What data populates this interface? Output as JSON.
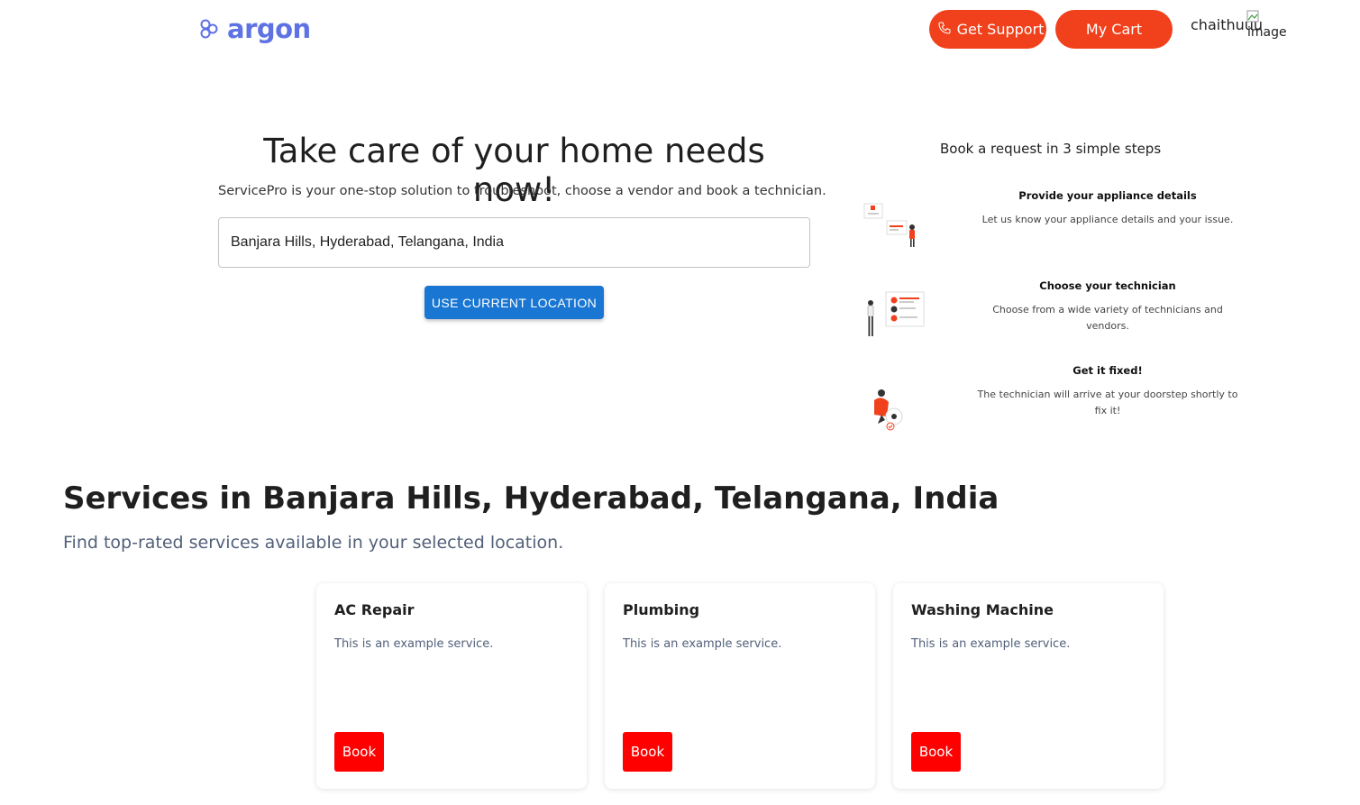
{
  "header": {
    "brand": "argon",
    "support_label": "Get Support",
    "cart_label": "My Cart",
    "username": "chaithuuu",
    "avatar_alt": "image"
  },
  "hero": {
    "title": "Take care of your home needs now!",
    "subtitle": "ServicePro is your one-stop solution to troubleshoot, choose a vendor and book a technician.",
    "location_value": "Banjara Hills, Hyderabad, Telangana, India",
    "use_location_label": "USE CURRENT LOCATION"
  },
  "steps": {
    "title": "Book a request in 3 simple steps",
    "items": [
      {
        "heading": "Provide your appliance details",
        "description": "Let us know your appliance details and your issue."
      },
      {
        "heading": "Choose your technician",
        "description": "Choose from a wide variety of technicians and vendors."
      },
      {
        "heading": "Get it fixed!",
        "description": "The technician will arrive at your doorstep shortly to fix it!"
      }
    ]
  },
  "services": {
    "title": "Services in Banjara Hills, Hyderabad, Telangana, India",
    "subtitle": "Find top-rated services available in your selected location.",
    "cards": [
      {
        "name": "AC Repair",
        "description": "This is an example service.",
        "button": "Book"
      },
      {
        "name": "Plumbing",
        "description": "This is an example service.",
        "button": "Book"
      },
      {
        "name": "Washing Machine",
        "description": "This is an example service.",
        "button": "Book"
      }
    ]
  },
  "colors": {
    "brand": "#5e72e4",
    "accent": "#f0411c",
    "primary_button": "#1976d2",
    "book_button": "#ff0000"
  }
}
